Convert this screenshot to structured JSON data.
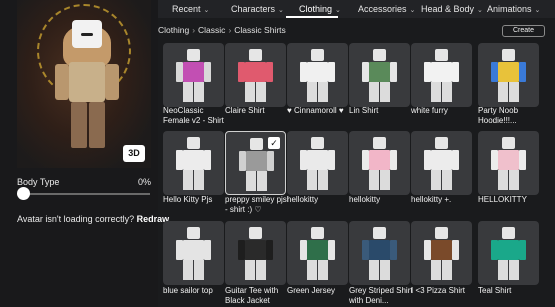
{
  "tabs": [
    {
      "label": "Recent",
      "active": false
    },
    {
      "label": "Characters",
      "active": false
    },
    {
      "label": "Clothing",
      "active": true
    },
    {
      "label": "Accessories",
      "active": false
    },
    {
      "label": "Head & Body",
      "active": false
    },
    {
      "label": "Animations",
      "active": false
    }
  ],
  "breadcrumb": [
    "Clothing",
    "Classic",
    "Classic Shirts"
  ],
  "create_label": "Create",
  "avatar": {
    "view_3d_label": "3D",
    "body_type_label": "Body Type",
    "body_type_value": "0%",
    "body_type_fraction": 0.0,
    "redraw_prompt": "Avatar isn't loading correctly?",
    "redraw_label": "Redraw"
  },
  "items": [
    {
      "name": "NeoClassic Female v2 - Shirt",
      "color": "#c24fb3",
      "sleeve": "#d8d8d8",
      "selected": false
    },
    {
      "name": "Claire Shirt",
      "color": "#e05a6e",
      "sleeve": "#e05a6e",
      "selected": false
    },
    {
      "name": "♥ Cinnamoroll ♥",
      "color": "#f0f0f0",
      "sleeve": "#f0f0f0",
      "selected": false
    },
    {
      "name": "Lin Shirt",
      "color": "#5a8a5a",
      "sleeve": "#e6e6e6",
      "selected": false
    },
    {
      "name": "white furry",
      "color": "#f2f2f2",
      "sleeve": "#f2f2f2",
      "selected": false
    },
    {
      "name": "Party Noob Hoodie!!!...",
      "color": "#e8c23a",
      "sleeve": "#3a7ad8",
      "selected": false
    },
    {
      "name": "Hello Kitty Pjs",
      "color": "#ececec",
      "sleeve": "#ececec",
      "selected": false
    },
    {
      "name": "preppy smiley pjsl - shirt :) ♡",
      "color": "#9a9a9a",
      "sleeve": "#d0d0d0",
      "selected": true
    },
    {
      "name": "hellokitty",
      "color": "#eaeaea",
      "sleeve": "#eaeaea",
      "selected": false
    },
    {
      "name": "hellokitty",
      "color": "#f2b6c8",
      "sleeve": "#eaeaea",
      "selected": false
    },
    {
      "name": "hellokitty +.",
      "color": "#ececec",
      "sleeve": "#ececec",
      "selected": false
    },
    {
      "name": "HELLOKITTY",
      "color": "#f0c0cc",
      "sleeve": "#ececec",
      "selected": false
    },
    {
      "name": "blue sailor top",
      "color": "#e4e4e4",
      "sleeve": "#e4e4e4",
      "selected": false
    },
    {
      "name": "Guitar Tee with Black Jacket",
      "color": "#2a2a2a",
      "sleeve": "#1e1e1e",
      "selected": false
    },
    {
      "name": "Green Jersey",
      "color": "#2f6f4a",
      "sleeve": "#e6e6e6",
      "selected": false
    },
    {
      "name": "Grey Striped Shirt with Deni...",
      "color": "#2a4a6a",
      "sleeve": "#3a5a7a",
      "selected": false
    },
    {
      "name": "I <3 Pizza Shirt",
      "color": "#7a4a2a",
      "sleeve": "#e6e6e6",
      "selected": false
    },
    {
      "name": "Teal Shirt",
      "color": "#1aa88a",
      "sleeve": "#1aa88a",
      "selected": false
    }
  ],
  "colors": {
    "background": "#1a1b1d",
    "card": "#393a3d",
    "tab_bar": "#222326"
  }
}
